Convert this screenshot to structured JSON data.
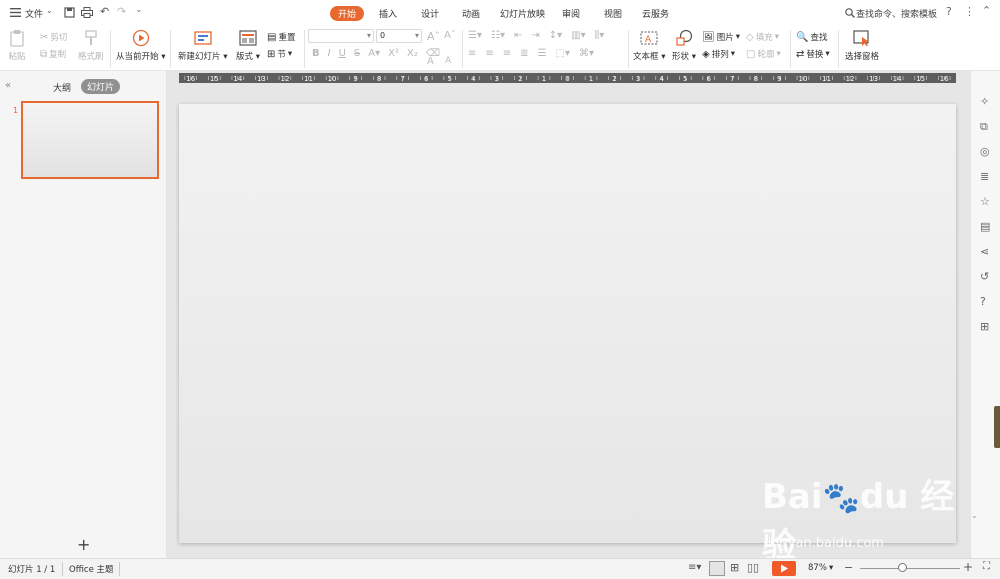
{
  "file_menu": {
    "label": "文件"
  },
  "tabs": [
    "开始",
    "插入",
    "设计",
    "动画",
    "幻灯片放映",
    "审阅",
    "视图",
    "云服务"
  ],
  "active_tab": "开始",
  "search": {
    "placeholder": "查找命令、搜索模板"
  },
  "ribbon": {
    "paste": "粘贴",
    "cut": "剪切",
    "copy": "复制",
    "format_painter": "格式刷",
    "play_from_current": "从当前开始",
    "new_slide": "新建幻灯片",
    "layout": "版式",
    "reset": "重置",
    "section": "节",
    "font_size_value": "0",
    "bold": "B",
    "italic": "I",
    "underline": "U",
    "strike": "S",
    "textbox": "文本框",
    "shape": "形状",
    "picture": "图片",
    "arrange": "排列",
    "fill": "填充",
    "outline": "轮廓",
    "find": "查找",
    "replace": "替换",
    "select_pane": "选择窗格"
  },
  "left_panel": {
    "tab_outline": "大纲",
    "tab_slides": "幻灯片",
    "slide_number": "1"
  },
  "ruler_labels": [
    "16",
    "15",
    "14",
    "13",
    "12",
    "11",
    "10",
    "9",
    "8",
    "7",
    "6",
    "5",
    "4",
    "3",
    "2",
    "1",
    "0",
    "1",
    "2",
    "3",
    "4",
    "5",
    "6",
    "7",
    "8",
    "9",
    "10",
    "11",
    "12",
    "13",
    "14",
    "15",
    "16"
  ],
  "status": {
    "slide_info": "幻灯片 1 / 1",
    "theme": "Office 主题",
    "zoom": "87%",
    "zoom_fraction": 0.42
  },
  "watermark": {
    "brand": "Bai du 经验",
    "url": "jingyan.baidu.com"
  },
  "colors": {
    "accent": "#e8692f",
    "play": "#f05a28"
  }
}
